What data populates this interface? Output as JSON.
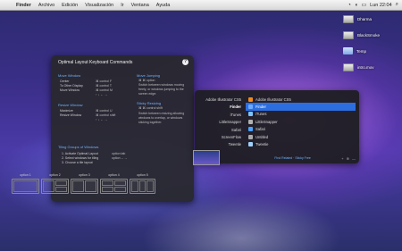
{
  "menubar": {
    "apple": "",
    "items": [
      "Finder",
      "Archivo",
      "Edición",
      "Visualización",
      "Ir",
      "Ventana",
      "Ayuda"
    ],
    "clock": "Lun 22:04"
  },
  "desktop": {
    "items": [
      {
        "label": "Dharma",
        "icon": "drive-icon"
      },
      {
        "label": "BlackSmoke",
        "icon": "drive-icon"
      },
      {
        "label": "Temp",
        "icon": "folder-icon"
      },
      {
        "label": "intro.mov",
        "icon": "file-icon"
      }
    ]
  },
  "panel": {
    "title": "Optimal Layout Keyboard Commands",
    "help": "?",
    "move_window": {
      "heading": "Move Window",
      "rows": [
        {
          "k": "Center",
          "v": "⌘ control F"
        },
        {
          "k": "To Other Display",
          "v": "⌘ control T"
        },
        {
          "k": "Move Window",
          "v": "⌘ control M"
        },
        {
          "k": "",
          "v": "↑ ↓ ← →"
        }
      ]
    },
    "resize_window": {
      "heading": "Resize Window",
      "rows": [
        {
          "k": "Maximize",
          "v": "⌘ control U"
        },
        {
          "k": "Resize Window",
          "v": "⌘ control shift"
        },
        {
          "k": "",
          "v": "↑ ↓ ← →"
        }
      ]
    },
    "move_jumping": {
      "heading": "Move Jumping",
      "shortcut": "⌘ ⌘ option",
      "desc": "Switch between windows moving freely, or windows jumping to the screen edge."
    },
    "sticky_resizing": {
      "heading": "Sticky Resizing",
      "shortcut": "⌘ ⌘ control shift",
      "desc": "Switch between resizing allowing windows to overlap, or windows sticking together."
    },
    "tiling": {
      "heading": "Tiling Groups of Windows",
      "steps": [
        {
          "k": "1. Activate Optimal Layout",
          "v": "option tab"
        },
        {
          "k": "2. Select windows for tiling",
          "v": "option ←→"
        },
        {
          "k": "3. Choose a tile layout",
          "v": ""
        }
      ],
      "options": [
        "option 1",
        "option 2",
        "option 3",
        "option 4",
        "option 5"
      ]
    }
  },
  "switcher": {
    "apps": [
      "Adobe Illustrator CS5",
      "Finder",
      "iTunes",
      "LittleSnapper",
      "Safari",
      "ScreenFlow",
      "Tweetie"
    ],
    "right": [
      "Adobe Illustrator CS5",
      "Finder",
      "iTunes",
      "LittleSnapper",
      "Safari",
      "Untitled",
      "Tweetie"
    ],
    "selected_index": 1,
    "footer_text": "Find Related · Sticky Free",
    "footer_buttons": [
      "+",
      "⊕",
      "—"
    ]
  }
}
